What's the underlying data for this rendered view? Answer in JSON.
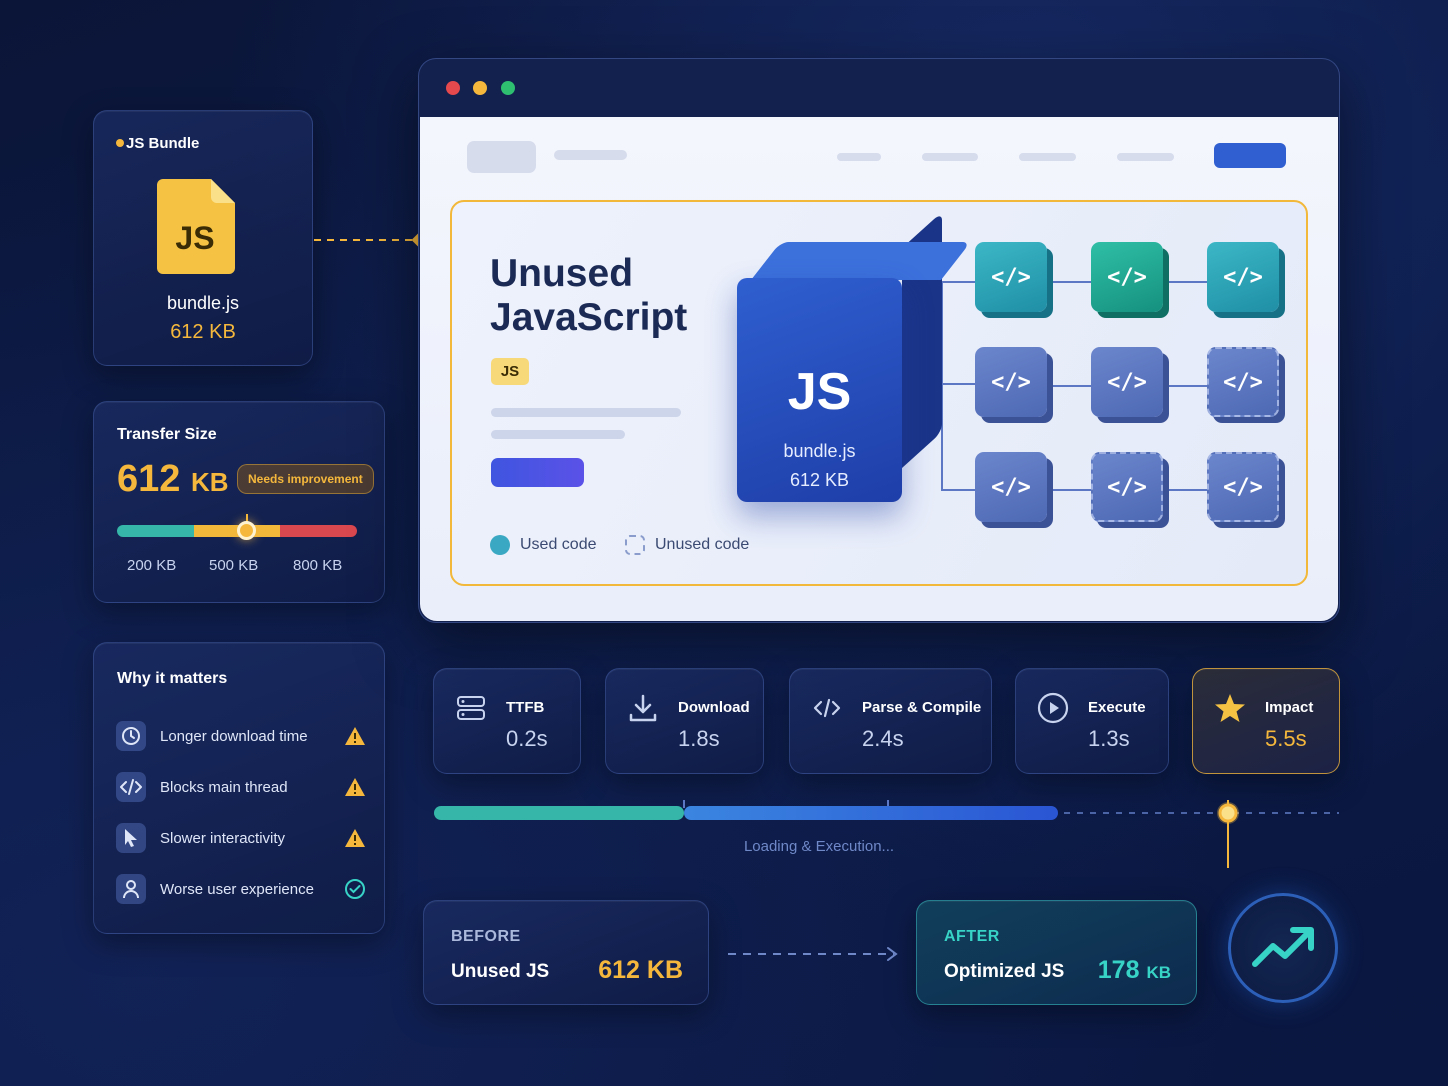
{
  "bundle_card": {
    "title": "JS Bundle",
    "file_icon_label": "JS",
    "file_name": "bundle.js",
    "file_size": "612 KB",
    "accent": "#f5b83c"
  },
  "transfer_card": {
    "label": "Transfer Size",
    "value": "612",
    "unit": "KB",
    "badge": "Needs improvement",
    "scale_ticks": [
      "200 KB",
      "500 KB",
      "800 KB"
    ],
    "marker_value_kb": 500,
    "scale_colors": [
      "#35b6a8",
      "#f2b83a",
      "#d9474f"
    ]
  },
  "why_card": {
    "label": "Why it matters",
    "items": [
      {
        "icon": "clock-icon",
        "text": "Longer download time",
        "status": "warning"
      },
      {
        "icon": "code-icon",
        "text": "Blocks main thread",
        "status": "warning"
      },
      {
        "icon": "cursor-icon",
        "text": "Slower interactivity",
        "status": "warning"
      },
      {
        "icon": "user-icon",
        "text": "Worse user experience",
        "status": "check"
      }
    ]
  },
  "browser": {
    "traffic_lights": [
      "#e5484d",
      "#f5b83c",
      "#2fbf71"
    ],
    "hero": {
      "title_line1": "Unused",
      "title_line2": "JavaScript",
      "tag": "JS",
      "legend_used": "Used code",
      "legend_unused": "Unused code"
    },
    "cube": {
      "label": "JS",
      "file_name": "bundle.js",
      "file_size": "612 KB"
    },
    "module_symbol": "</>"
  },
  "metrics": [
    {
      "icon": "server-icon",
      "name": "TTFB",
      "value": "0.2s"
    },
    {
      "icon": "download-icon",
      "name": "Download",
      "value": "1.8s"
    },
    {
      "icon": "code-icon",
      "name": "Parse & Compile",
      "value": "2.4s"
    },
    {
      "icon": "play-icon",
      "name": "Execute",
      "value": "1.3s"
    },
    {
      "icon": "star-icon",
      "name": "Impact",
      "value": "5.5s"
    }
  ],
  "timeline": {
    "caption": "Loading & Execution..."
  },
  "before": {
    "heading": "BEFORE",
    "name": "Unused JS",
    "value": "612 KB"
  },
  "after": {
    "heading": "AFTER",
    "name": "Optimized JS",
    "value": "178",
    "unit": "KB"
  },
  "trend_icon": "trending-up-icon"
}
